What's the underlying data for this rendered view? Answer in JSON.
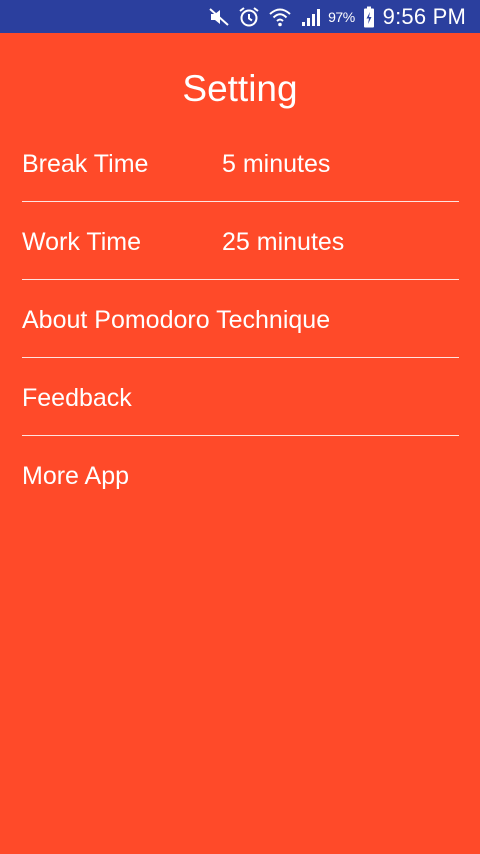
{
  "status_bar": {
    "icons": [
      "mute-icon",
      "alarm-icon",
      "wifi-icon",
      "signal-icon",
      "battery-icon"
    ],
    "battery_percent": "97%",
    "time": "9:56 PM",
    "background_color": "#2b3f9e"
  },
  "screen": {
    "title": "Setting",
    "background_color": "#ff4a29",
    "text_color": "#ffffff"
  },
  "settings": {
    "items": [
      {
        "label": "Break Time",
        "value": "5 minutes"
      },
      {
        "label": "Work Time",
        "value": "25 minutes"
      },
      {
        "label": "About Pomodoro Technique"
      },
      {
        "label": "Feedback"
      },
      {
        "label": "More App"
      }
    ]
  }
}
